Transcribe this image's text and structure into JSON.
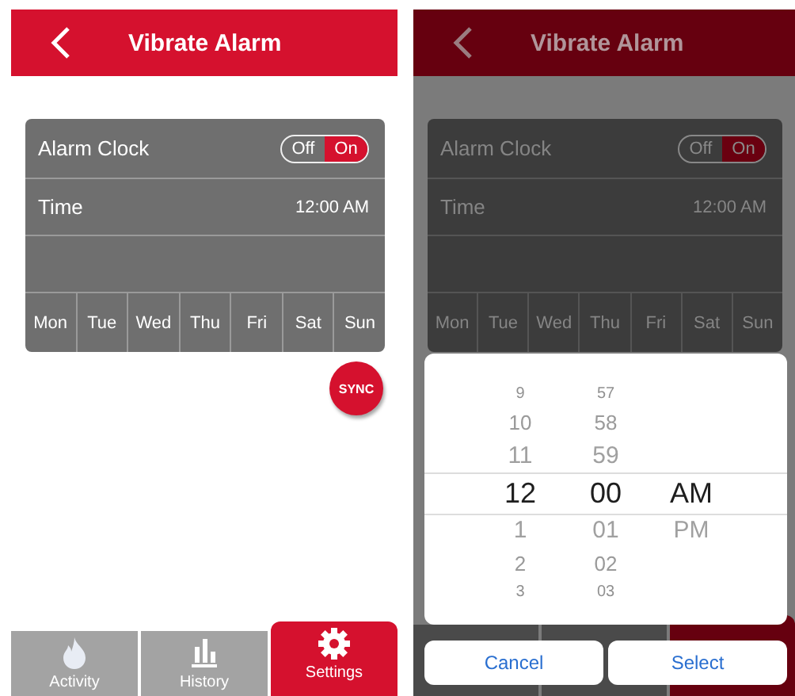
{
  "screens": [
    {
      "kind": "main",
      "dimmed": false,
      "header": {
        "title": "Vibrate Alarm"
      },
      "alarm": {
        "label": "Alarm Clock",
        "off_label": "Off",
        "on_label": "On",
        "on": true
      },
      "time": {
        "label": "Time",
        "value": "12:00 AM"
      },
      "days": [
        "Mon",
        "Tue",
        "Wed",
        "Thu",
        "Fri",
        "Sat",
        "Sun"
      ],
      "sync_button": "SYNC",
      "tabs": [
        {
          "label": "Activity",
          "selected": false
        },
        {
          "label": "History",
          "selected": false
        },
        {
          "label": "Settings",
          "selected": true
        }
      ]
    },
    {
      "kind": "picker",
      "dimmed": true,
      "header": {
        "title": "Vibrate Alarm"
      },
      "alarm": {
        "label": "Alarm Clock",
        "off_label": "Off",
        "on_label": "On",
        "on": true
      },
      "time": {
        "label": "Time",
        "value": "12:00 AM"
      },
      "days": [
        "Mon",
        "Tue",
        "Wed",
        "Thu",
        "Fri",
        "Sat",
        "Sun"
      ],
      "picker": {
        "columns": [
          [
            {
              "text": "9",
              "selected": false
            },
            {
              "text": "10",
              "selected": false
            },
            {
              "text": "11",
              "selected": false
            },
            {
              "text": "12",
              "selected": true
            },
            {
              "text": "1",
              "selected": false
            },
            {
              "text": "2",
              "selected": false
            },
            {
              "text": "3",
              "selected": false
            }
          ],
          [
            {
              "text": "57",
              "selected": false
            },
            {
              "text": "58",
              "selected": false
            },
            {
              "text": "59",
              "selected": false
            },
            {
              "text": "00",
              "selected": true
            },
            {
              "text": "01",
              "selected": false
            },
            {
              "text": "02",
              "selected": false
            },
            {
              "text": "03",
              "selected": false
            }
          ],
          [
            {
              "text": "AM",
              "selected": true
            },
            {
              "text": "PM",
              "selected": false
            }
          ]
        ]
      },
      "buttons": [
        "Cancel",
        "Select"
      ]
    }
  ]
}
